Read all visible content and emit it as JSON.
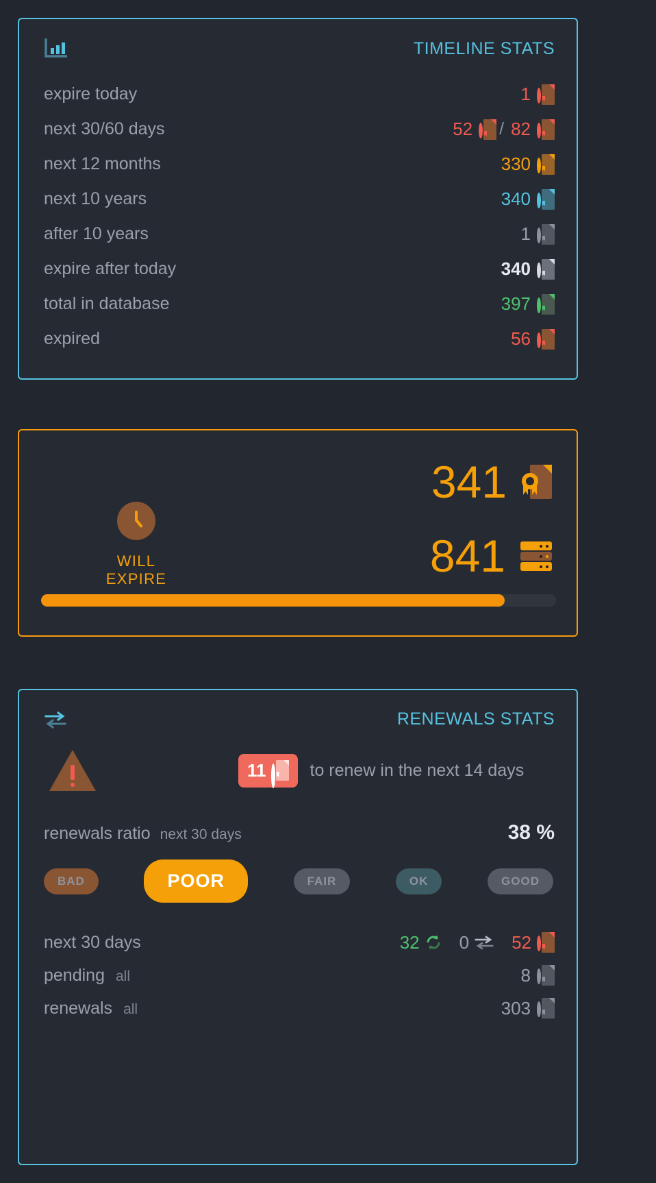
{
  "theme": {
    "bg": "#22262f",
    "card_bg": "#262a33",
    "accent_blue": "#56c2e0",
    "accent_orange": "#f5a009",
    "red": "#f05b4f",
    "green": "#4ec16c",
    "grey": "#9aa0ab",
    "white": "#e6e9ee",
    "brown": "#8a5532"
  },
  "timeline": {
    "icon": "bar-chart-icon",
    "title": "TIMELINE STATS",
    "rows": [
      {
        "label": "expire today",
        "value": "1",
        "color": "v-red",
        "icon_color": "#f05b4f",
        "bold": false,
        "second": null
      },
      {
        "label": "next 30/60 days",
        "value": "52",
        "color": "v-red",
        "icon_color": "#f05b4f",
        "bold": false,
        "second": {
          "value": "82",
          "color": "v-red",
          "icon_color": "#f05b4f"
        },
        "separator": "/"
      },
      {
        "label": "next 12 months",
        "value": "330",
        "color": "v-orange",
        "icon_color": "#f5a009",
        "bold": false,
        "second": null
      },
      {
        "label": "next 10 years",
        "value": "340",
        "color": "v-blue",
        "icon_color": "#56c2e0",
        "bold": false,
        "second": null
      },
      {
        "label": "after 10 years",
        "value": "1",
        "color": "v-grey",
        "icon_color": "#8d939d",
        "bold": false,
        "second": null
      },
      {
        "label": "expire after today",
        "value": "340",
        "color": "v-white",
        "icon_color": "#d7dbe1",
        "bold": true,
        "second": null
      },
      {
        "label": "total in database",
        "value": "397",
        "color": "v-green",
        "icon_color": "#4ec16c",
        "bold": false,
        "second": null
      },
      {
        "label": "expired",
        "value": "56",
        "color": "v-red",
        "icon_color": "#f05b4f",
        "bold": false,
        "second": null
      }
    ]
  },
  "expire": {
    "clock_icon": "clock-icon",
    "caption": "WILL EXPIRE",
    "certificates_count": "341",
    "certificates_icon": "certificate-icon",
    "records_count": "841",
    "records_icon": "server-icon",
    "progress_percent": 90
  },
  "renewals": {
    "icon": "exchange-arrows-icon",
    "title": "RENEWALS STATS",
    "alert": {
      "warning_icon": "warning-triangle-icon",
      "badge_count": "11",
      "badge_icon": "certificate-icon",
      "text": "to renew in the next 14 days"
    },
    "ratio": {
      "label": "renewals ratio",
      "sublabel": "next 30 days",
      "value": "38 %"
    },
    "scale": [
      {
        "label": "BAD",
        "state": "bad",
        "active": false
      },
      {
        "label": "POOR",
        "state": "active",
        "active": true
      },
      {
        "label": "FAIR",
        "state": "fair",
        "active": false
      },
      {
        "label": "OK",
        "state": "ok",
        "active": false
      },
      {
        "label": "GOOD",
        "state": "good",
        "active": false
      }
    ],
    "next30": {
      "label": "next 30 days",
      "renewed": "32",
      "renewed_icon": "refresh-icon",
      "transferred": "0",
      "transferred_icon": "swap-icon",
      "expiring": "52",
      "expiring_icon": "certificate-icon"
    },
    "rows": [
      {
        "label": "pending",
        "sublabel": "all",
        "value": "8",
        "icon": "certificate-icon"
      },
      {
        "label": "renewals",
        "sublabel": "all",
        "value": "303",
        "icon": "certificate-icon"
      }
    ]
  }
}
